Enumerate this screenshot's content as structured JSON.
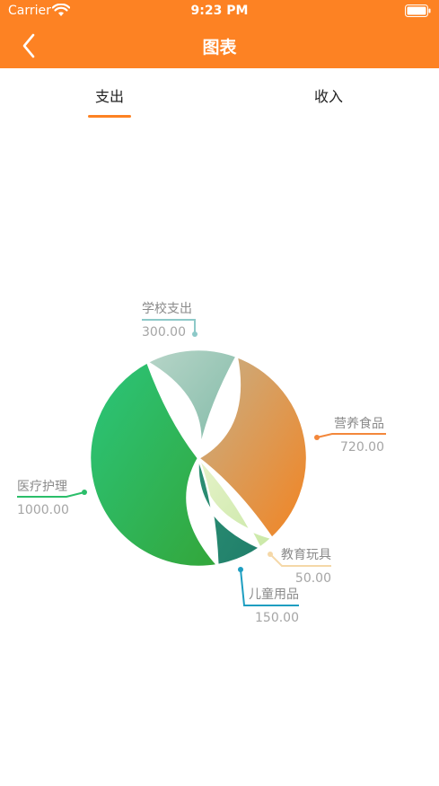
{
  "status_bar": {
    "carrier": "Carrier",
    "time": "9:23 PM"
  },
  "nav": {
    "title": "图表",
    "back_icon": "chevron-left-icon"
  },
  "tabs": [
    {
      "label": "支出",
      "active": true
    },
    {
      "label": "收入",
      "active": false
    }
  ],
  "colors": {
    "accent": "#FD8223",
    "school": "#8DC9C8",
    "food": "#F3873B",
    "edu": "#F5D8A8",
    "kids": "#1E9EC1",
    "medical": "#2BBE6A"
  },
  "chart_data": {
    "type": "pie",
    "title": "",
    "slices": [
      {
        "label": "学校支出",
        "value": 300.0,
        "display": "300.00"
      },
      {
        "label": "营养食品",
        "value": 720.0,
        "display": "720.00"
      },
      {
        "label": "教育玩具",
        "value": 50.0,
        "display": "50.00"
      },
      {
        "label": "儿童用品",
        "value": 150.0,
        "display": "150.00"
      },
      {
        "label": "医疗护理",
        "value": 1000.0,
        "display": "1000.00"
      }
    ]
  }
}
